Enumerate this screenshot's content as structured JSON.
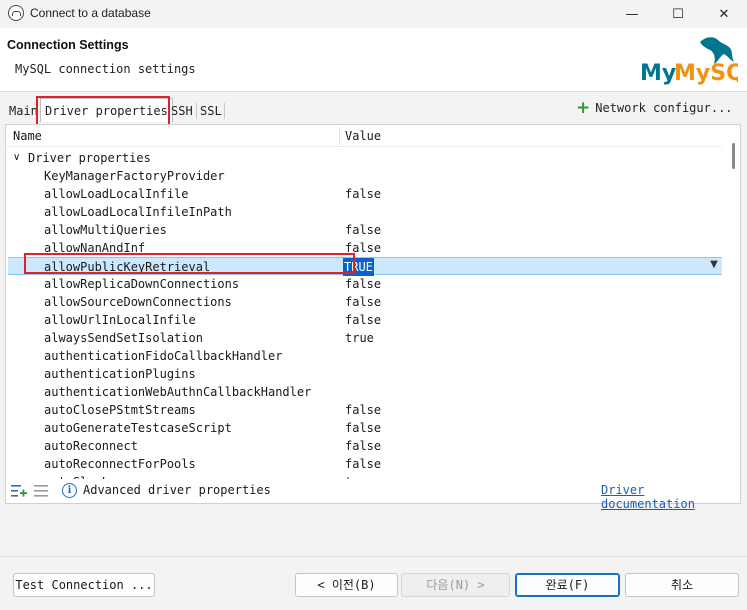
{
  "window": {
    "title": "Connect to a database",
    "minimize_icon": "minimize-icon",
    "maximize_icon": "maximize-icon",
    "close_icon": "close-icon"
  },
  "header": {
    "title": "Connection Settings",
    "subtitle": "MySQL connection settings",
    "logo_text": "MySQL"
  },
  "tabs": {
    "main": "Main",
    "driver": "Driver properties",
    "ssh": "SSH",
    "ssl": "SSL",
    "network": "Network configur..."
  },
  "table": {
    "col_name": "Name",
    "col_value": "Value",
    "group_label": "Driver properties",
    "rows": [
      {
        "name": "KeyManagerFactoryProvider",
        "value": ""
      },
      {
        "name": "allowLoadLocalInfile",
        "value": "false"
      },
      {
        "name": "allowLoadLocalInfileInPath",
        "value": ""
      },
      {
        "name": "allowMultiQueries",
        "value": "false"
      },
      {
        "name": "allowNanAndInf",
        "value": "false"
      },
      {
        "name": "allowPublicKeyRetrieval",
        "value": "TRUE"
      },
      {
        "name": "allowReplicaDownConnections",
        "value": "false"
      },
      {
        "name": "allowSourceDownConnections",
        "value": "false"
      },
      {
        "name": "allowUrlInLocalInfile",
        "value": "false"
      },
      {
        "name": "alwaysSendSetIsolation",
        "value": "true"
      },
      {
        "name": "authenticationFidoCallbackHandler",
        "value": ""
      },
      {
        "name": "authenticationPlugins",
        "value": ""
      },
      {
        "name": "authenticationWebAuthnCallbackHandler",
        "value": ""
      },
      {
        "name": "autoClosePStmtStreams",
        "value": "false"
      },
      {
        "name": "autoGenerateTestcaseScript",
        "value": "false"
      },
      {
        "name": "autoReconnect",
        "value": "false"
      },
      {
        "name": "autoReconnectForPools",
        "value": "false"
      },
      {
        "name": "autoSlowLog",
        "value": "true"
      }
    ]
  },
  "footer": {
    "advanced_label": "Advanced driver properties",
    "doc_link": "Driver documentation"
  },
  "buttons": {
    "test": "Test Connection ...",
    "prev": "< 이전(B)",
    "next": "다음(N) >",
    "finish": "완료(F)",
    "cancel": "취소"
  },
  "colors": {
    "selection_bg": "#cce8ff",
    "selected_value_bg": "#0a63c9",
    "highlight_box": "#d9232d",
    "mysql_blue": "#00758f",
    "mysql_orange": "#f29111"
  }
}
